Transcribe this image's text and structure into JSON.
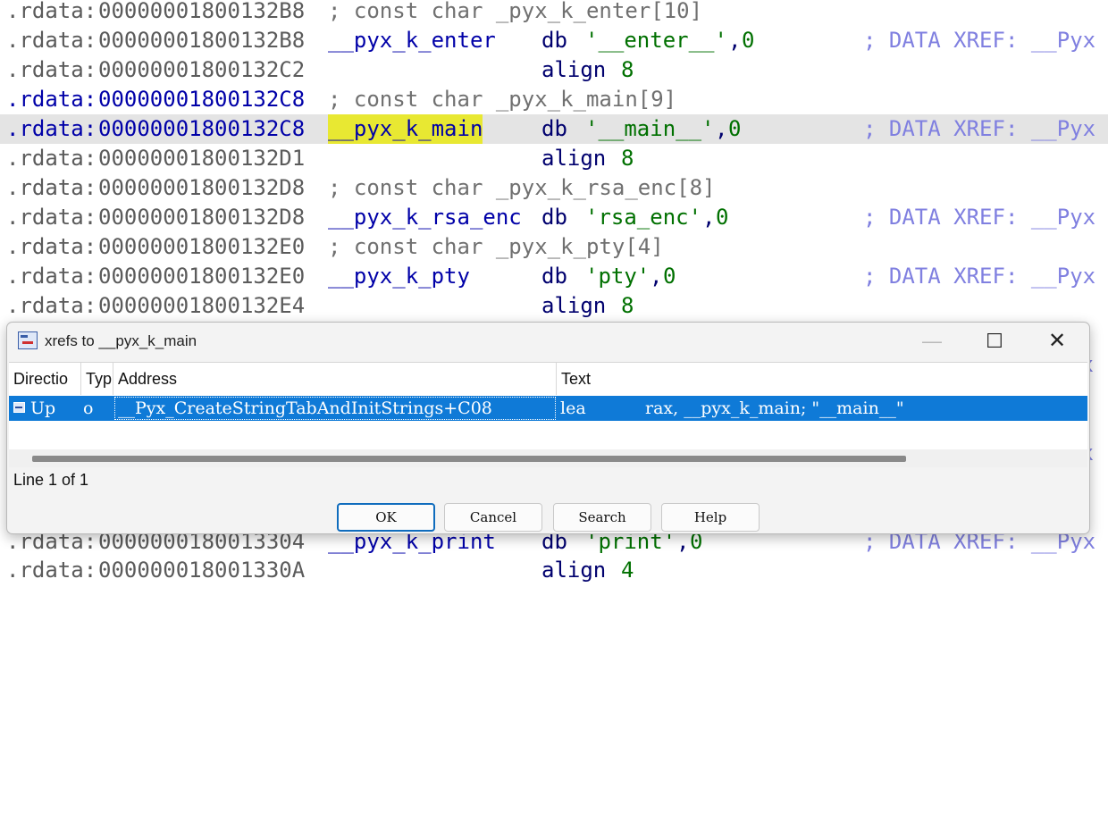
{
  "listing": [
    {
      "seg": ".rdata:",
      "addr": "00000001800132B8",
      "comment": "; const char _pyx_k_enter[10]"
    },
    {
      "seg": ".rdata:",
      "addr": "00000001800132B8",
      "sym": "__pyx_k_enter",
      "mnem": "db",
      "operand": "'__enter__'",
      "sep": ",",
      "num": "0",
      "xref": "; DATA XREF: __Pyx"
    },
    {
      "seg": ".rdata:",
      "addr": "00000001800132C2",
      "mnem": "align",
      "num": "8"
    },
    {
      "seg": ".rdata:",
      "addr": "00000001800132C8",
      "comment": "; const char _pyx_k_main[9]"
    },
    {
      "seg": ".rdata:",
      "addr": "00000001800132C8",
      "sym": "__pyx_k_main",
      "mnem": "db",
      "operand": "'__main__'",
      "sep": ",",
      "num": "0",
      "xref": "; DATA XREF: __Pyx"
    },
    {
      "seg": ".rdata:",
      "addr": "00000001800132D1",
      "mnem": "align",
      "num": "8"
    },
    {
      "seg": ".rdata:",
      "addr": "00000001800132D8",
      "comment": "; const char _pyx_k_rsa_enc[8]"
    },
    {
      "seg": ".rdata:",
      "addr": "00000001800132D8",
      "sym": "__pyx_k_rsa_enc",
      "mnem": "db",
      "operand": "'rsa_enc'",
      "sep": ",",
      "num": "0",
      "xref": "; DATA XREF: __Pyx"
    },
    {
      "seg": ".rdata:",
      "addr": "00000001800132E0",
      "comment": "; const char _pyx_k_pty[4]"
    },
    {
      "seg": ".rdata:",
      "addr": "00000001800132E0",
      "sym": "__pyx_k_pty",
      "mnem": "db",
      "operand": "'pty'",
      "sep": ",",
      "num": "0",
      "xref": "; DATA XREF: __Pyx"
    },
    {
      "seg": ".rdata:",
      "addr": "00000001800132E4",
      "mnem": "align",
      "num": "8"
    },
    {
      "seg": ".rdata:",
      "addr": "0000000180013304",
      "sym": "__pyx_k_print",
      "mnem": "db",
      "operand": "'print'",
      "sep": ",",
      "num": "0",
      "xref": "; DATA XREF: __Pyx"
    },
    {
      "seg": ".rdata:",
      "addr": "000000018001330A",
      "mnem": "align",
      "num": "4"
    }
  ],
  "behind_dialog": [
    "Px",
    "Px"
  ],
  "dialog": {
    "title": "xrefs to __pyx_k_main",
    "columns": [
      "Directio",
      "Typ",
      "Address",
      "Text"
    ],
    "row": {
      "direction": "Up",
      "type": "o",
      "address": "__Pyx_CreateStringTabAndInitStrings+C08",
      "text_mnem": "lea",
      "text_ops": "rax, __pyx_k_main; \"__main__\""
    },
    "status": "Line 1 of 1",
    "buttons": {
      "ok": "OK",
      "cancel": "Cancel",
      "search": "Search",
      "help": "Help"
    }
  },
  "colors": {
    "selection": "#0f7ad7",
    "symbol_highlight": "#e8e832",
    "current_line": "#e4e4e4"
  }
}
